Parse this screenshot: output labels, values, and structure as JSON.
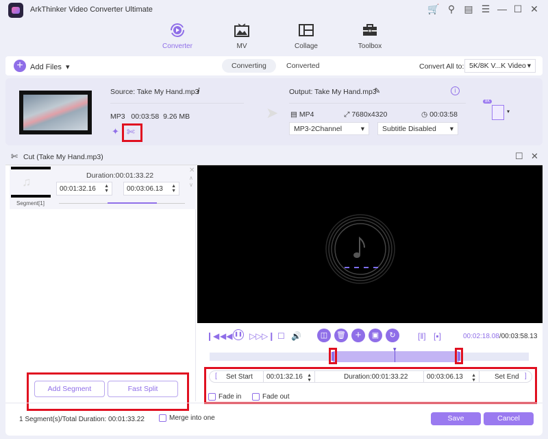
{
  "app": {
    "title": "ArkThinker Video Converter Ultimate"
  },
  "window_controls": [
    "cart-icon",
    "key-icon",
    "feedback-icon",
    "menu-icon",
    "minimize-icon",
    "maximize-icon",
    "close-icon"
  ],
  "nav": [
    {
      "label": "Converter",
      "icon": "converter-icon",
      "active": true
    },
    {
      "label": "MV",
      "icon": "mv-icon",
      "active": false
    },
    {
      "label": "Collage",
      "icon": "collage-icon",
      "active": false
    },
    {
      "label": "Toolbox",
      "icon": "toolbox-icon",
      "active": false
    }
  ],
  "toolbar": {
    "add_files": "Add Files",
    "tabs": [
      "Converting",
      "Converted"
    ],
    "convert_all_label": "Convert All to:",
    "convert_all_value": "5K/8K V...K Video"
  },
  "file": {
    "source": "Source: Take My Hand.mp3",
    "format": "MP3",
    "duration": "00:03:58",
    "size": "9.26 MB",
    "output": "Output: Take My Hand.mp3",
    "out_format": "MP4",
    "resolution": "7680x4320",
    "out_duration": "00:03:58",
    "audio_select": "MP3-2Channel",
    "subtitle_select": "Subtitle Disabled",
    "format_badge": "8K"
  },
  "cut": {
    "title": "Cut (Take My Hand.mp3)",
    "segment": {
      "duration": "Duration:00:01:33.22",
      "start": "00:01:32.16",
      "end": "00:03:06.13",
      "label": "Segment[1]"
    },
    "player": {
      "current_time": "00:02:18.08",
      "total_time": "/00:03:58.13",
      "selection_start": 0.387,
      "selection_end": 0.781,
      "playhead": 0.58
    },
    "set_start": "Set Start",
    "set_end": "Set End",
    "start_time": "00:01:32.16",
    "end_time": "00:03:06.13",
    "duration": "Duration:00:01:33.22",
    "fade_in": "Fade in",
    "fade_out": "Fade out",
    "add_segment": "Add Segment",
    "fast_split": "Fast Split",
    "summary": "1 Segment(s)/Total Duration: 00:01:33.22",
    "merge": "Merge into one",
    "save": "Save",
    "cancel": "Cancel"
  },
  "colors": {
    "accent": "#8f6ee8",
    "highlight": "#e01020"
  }
}
